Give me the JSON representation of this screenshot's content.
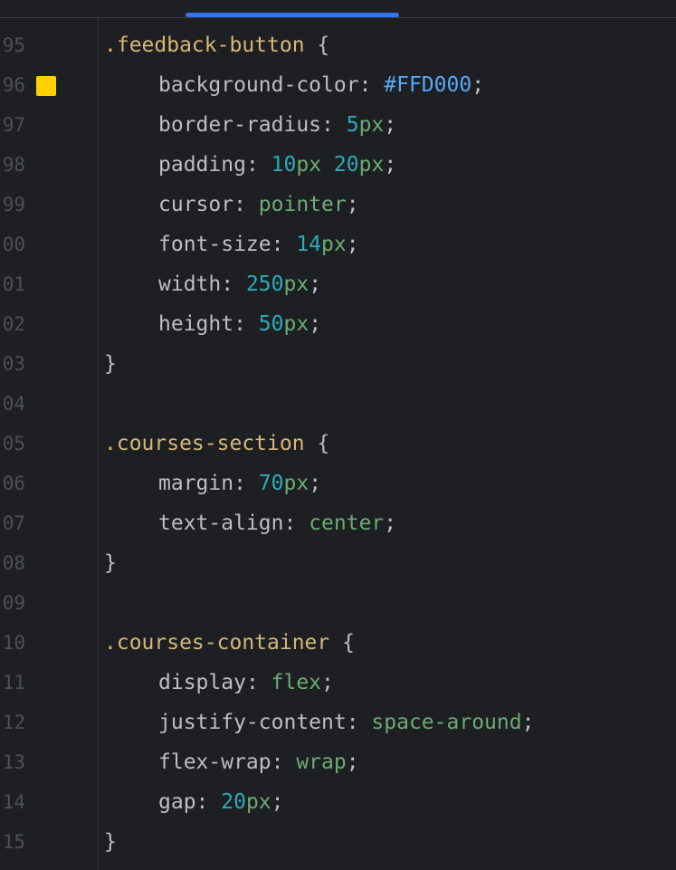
{
  "editor": {
    "colors": {
      "background": "#1e1f22",
      "tab_indicator": "#3574f0",
      "swatch": "#FFD000"
    },
    "lines": [
      {
        "number": "95",
        "selector": ".feedback-button",
        "brace": " {"
      },
      {
        "number": "96",
        "prop": "background-color",
        "colon": ": ",
        "hex": "#FFD000",
        "semi": ";"
      },
      {
        "number": "97",
        "prop": "border-radius",
        "colon": ": ",
        "n1": "5",
        "u1": "px",
        "semi": ";"
      },
      {
        "number": "98",
        "prop": "padding",
        "colon": ": ",
        "n1": "10",
        "u1": "px",
        "sp": " ",
        "n2": "20",
        "u2": "px",
        "semi": ";"
      },
      {
        "number": "99",
        "prop": "cursor",
        "colon": ": ",
        "kw": "pointer",
        "semi": ";"
      },
      {
        "number": "00",
        "prop": "font-size",
        "colon": ": ",
        "n1": "14",
        "u1": "px",
        "semi": ";"
      },
      {
        "number": "01",
        "prop": "width",
        "colon": ": ",
        "n1": "250",
        "u1": "px",
        "semi": ";"
      },
      {
        "number": "02",
        "prop": "height",
        "colon": ": ",
        "n1": "50",
        "u1": "px",
        "semi": ";"
      },
      {
        "number": "03",
        "close": "}"
      },
      {
        "number": "04"
      },
      {
        "number": "05",
        "selector": ".courses-section",
        "brace": " {"
      },
      {
        "number": "06",
        "prop": "margin",
        "colon": ": ",
        "n1": "70",
        "u1": "px",
        "semi": ";"
      },
      {
        "number": "07",
        "prop": "text-align",
        "colon": ": ",
        "kw": "center",
        "semi": ";"
      },
      {
        "number": "08",
        "close": "}"
      },
      {
        "number": "09"
      },
      {
        "number": "10",
        "selector": ".courses-container",
        "brace": " {"
      },
      {
        "number": "11",
        "prop": "display",
        "colon": ": ",
        "kw": "flex",
        "semi": ";"
      },
      {
        "number": "12",
        "prop": "justify-content",
        "colon": ": ",
        "kw": "space-around",
        "semi": ";"
      },
      {
        "number": "13",
        "prop": "flex-wrap",
        "colon": ": ",
        "kw": "wrap",
        "semi": ";"
      },
      {
        "number": "14",
        "prop": "gap",
        "colon": ": ",
        "n1": "20",
        "u1": "px",
        "semi": ";"
      },
      {
        "number": "15",
        "close": "}"
      }
    ]
  }
}
